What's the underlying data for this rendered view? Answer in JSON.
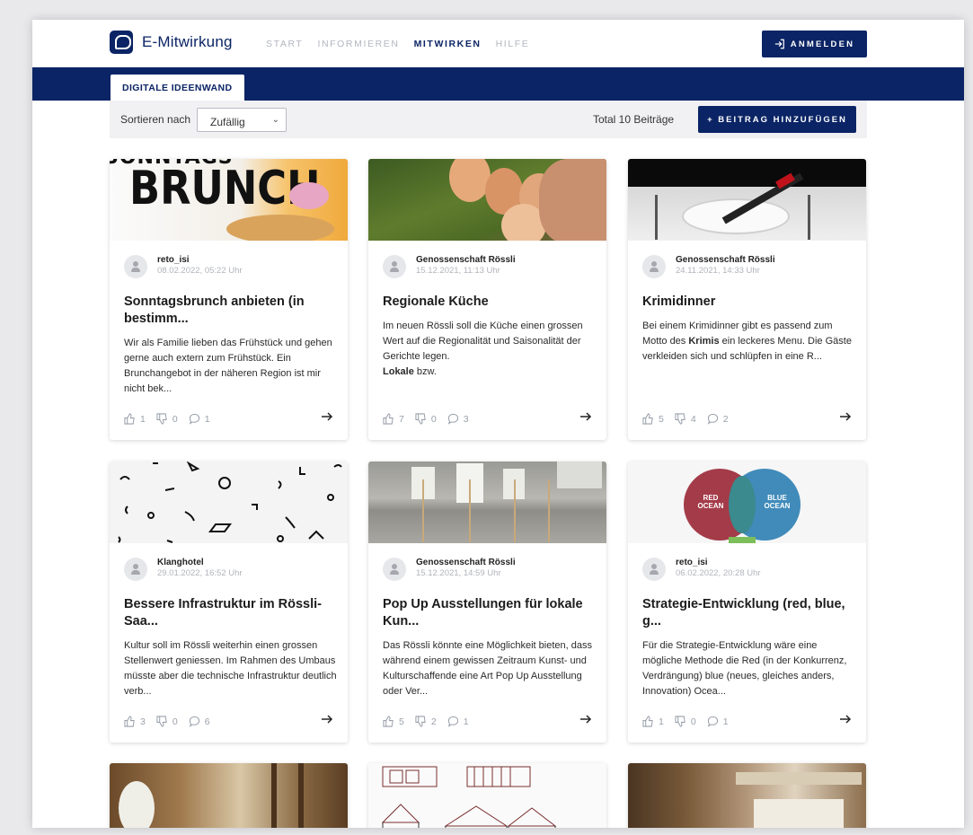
{
  "app": {
    "name": "E-Mitwirkung"
  },
  "nav": {
    "items": [
      "START",
      "INFORMIEREN",
      "MITWIRKEN",
      "HILFE"
    ],
    "active": "MITWIRKEN"
  },
  "header": {
    "login_label": "ANMELDEN"
  },
  "tab": {
    "label": "DIGITALE IDEENWAND"
  },
  "filter": {
    "sort_label": "Sortieren nach",
    "sort_value": "Zufällig",
    "total": "Total 10 Beiträge",
    "add_label": "+ BEITRAG HINZUFÜGEN"
  },
  "colors": {
    "brand": "#0b2465",
    "muted": "#b3b6bf",
    "filter_bg": "#f1f1f3"
  },
  "cards": [
    {
      "image_text": "BRUNCH",
      "image_text_top": "SONNTAGS",
      "author": "reto_isi",
      "date": "08.02.2022, 05:22 Uhr",
      "title": "Sonntagsbrunch anbieten (in bestimm...",
      "desc": "Wir als Familie lieben das Frühstück und gehen gerne auch extern zum Frühstück. Ein Brunchangebot in der näheren Region ist mir nicht bek...",
      "likes": "1",
      "dislikes": "0",
      "comments": "1"
    },
    {
      "author": "Genossenschaft Rössli",
      "date": "15.12.2021, 11:13 Uhr",
      "title": "Regionale Küche",
      "desc_a": "Im neuen Rössli soll die Küche einen grossen Wert auf die Regionalität und Saisonalität der Gerichte legen.",
      "desc_b_bold": "Lokale",
      "desc_b_rest": " bzw.",
      "likes": "7",
      "dislikes": "0",
      "comments": "3"
    },
    {
      "author": "Genossenschaft Rössli",
      "date": "24.11.2021, 14:33 Uhr",
      "title": "Krimidinner",
      "desc_a": "Bei einem Krimidinner gibt es passend zum Motto des ",
      "desc_bold": "Krimis",
      "desc_b": " ein leckeres Menu. Die Gäste verkleiden sich und schlüpfen in eine R...",
      "likes": "5",
      "dislikes": "4",
      "comments": "2"
    },
    {
      "author": "Klanghotel",
      "date": "29.01.2022, 16:52 Uhr",
      "title": "Bessere Infrastruktur im Rössli-Saa...",
      "desc": "Kultur soll im Rössli weiterhin einen grossen Stellenwert geniessen. Im Rahmen des Umbaus müsste aber die technische Infrastruktur deutlich verb...",
      "likes": "3",
      "dislikes": "0",
      "comments": "6"
    },
    {
      "author": "Genossenschaft Rössli",
      "date": "15.12.2021, 14:59 Uhr",
      "title": "Pop Up Ausstellungen für lokale Kun...",
      "desc": "Das Rössli könnte eine Möglichkeit bieten, dass während einem gewissen Zeitraum Kunst- und Kulturschaffende eine Art Pop Up Ausstellung oder Ver...",
      "likes": "5",
      "dislikes": "2",
      "comments": "1"
    },
    {
      "image_text_red": "RED OCEAN",
      "image_text_blue": "BLUE OCEAN",
      "author": "reto_isi",
      "date": "06.02.2022, 20:28 Uhr",
      "title": "Strategie-Entwicklung (red, blue, g...",
      "desc": "Für die Strategie-Entwicklung wäre eine mögliche Methode die Red (in der Konkurrenz, Verdrängung) blue (neues, gleiches anders, Innovation) Ocea...",
      "likes": "1",
      "dislikes": "0",
      "comments": "1"
    }
  ]
}
